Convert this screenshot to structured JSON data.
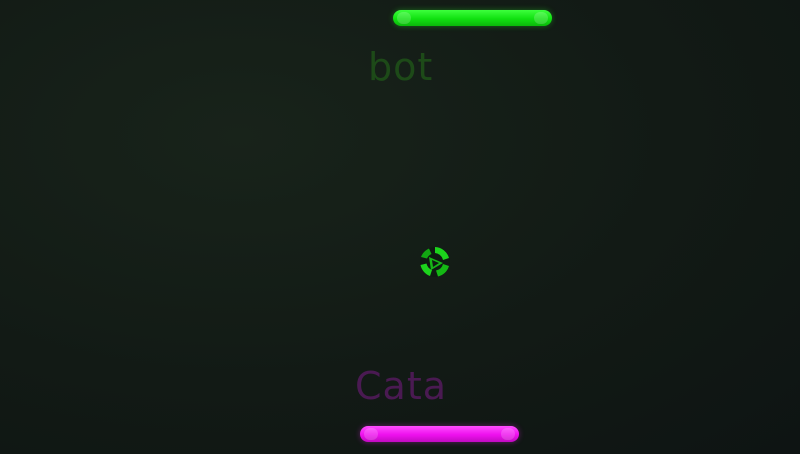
{
  "players": {
    "top": {
      "name": "bot",
      "color": "#11e111",
      "label_color": "#1d4a18"
    },
    "bottom": {
      "name": "Cata",
      "color": "#ee10ee",
      "label_color": "#4a1a52"
    }
  },
  "ball": {
    "icon": "spinning-ball-icon",
    "color": "#11cc11"
  },
  "background": "#121a15"
}
